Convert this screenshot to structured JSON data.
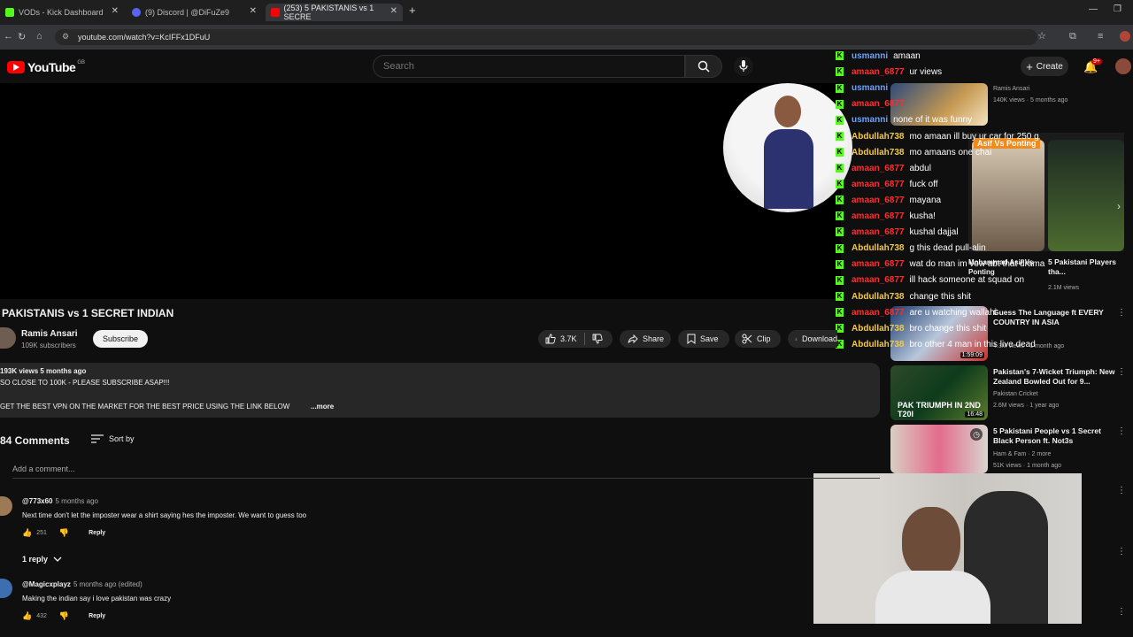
{
  "browser": {
    "tabs": [
      {
        "label": "VODs - Kick Dashboard",
        "color": "#53fc18"
      },
      {
        "label": "(9) Discord | @DiFuZe9",
        "color": "#5865f2"
      },
      {
        "label": "(253) 5 PAKISTANIS vs 1 SECRE",
        "color": "#ff0000"
      }
    ],
    "url": "youtube.com/watch?v=KcIFFx1DFuU"
  },
  "header": {
    "logo_text": "YouTube",
    "country": "GB",
    "search_placeholder": "Search",
    "create_label": "Create",
    "notif_badge": "9+"
  },
  "chat": {
    "lines": [
      {
        "user": "usmanni",
        "msg": "amaan",
        "color": "#6aa2ff"
      },
      {
        "user": "amaan_6877",
        "msg": "ur views",
        "color": "#ff2d2d"
      },
      {
        "user": "usmanni",
        "msg": "",
        "color": "#6aa2ff"
      },
      {
        "user": "amaan_6877",
        "msg": "",
        "color": "#ff2d2d"
      },
      {
        "user": "usmanni",
        "msg": "none of it was funny",
        "color": "#6aa2ff"
      },
      {
        "user": "Abdullah738",
        "msg": "mo amaan ill buy ur car for 250 g",
        "color": "#f2c94c"
      },
      {
        "user": "Abdullah738",
        "msg": "mo amaans one chai",
        "color": "#f2c94c"
      },
      {
        "user": "amaan_6877",
        "msg": "abdul",
        "color": "#ff2d2d"
      },
      {
        "user": "amaan_6877",
        "msg": "fuck off",
        "color": "#ff2d2d"
      },
      {
        "user": "amaan_6877",
        "msg": "mayana",
        "color": "#ff2d2d"
      },
      {
        "user": "amaan_6877",
        "msg": "kusha!",
        "color": "#ff2d2d"
      },
      {
        "user": "amaan_6877",
        "msg": "kushal dajjal",
        "color": "#ff2d2d"
      },
      {
        "user": "Abdullah738",
        "msg": "g this dead pull-alin",
        "color": "#f2c94c"
      },
      {
        "user": "amaan_6877",
        "msg": "wat do man im vow abt that drama",
        "color": "#ff2d2d"
      },
      {
        "user": "amaan_6877",
        "msg": "ill hack someone at squad on",
        "color": "#ff2d2d"
      },
      {
        "user": "Abdullah738",
        "msg": "change this shit",
        "color": "#f2c94c"
      },
      {
        "user": "amaan_6877",
        "msg": "are u watching wallahi",
        "color": "#ff2d2d"
      },
      {
        "user": "Abdullah738",
        "msg": "bro change this shit",
        "color": "#f2c94c"
      },
      {
        "user": "Abdullah738",
        "msg": "bro other 4 man in this live dead",
        "color": "#f2c94c"
      }
    ]
  },
  "video": {
    "title": "PAKISTANIS vs 1 SECRET INDIAN",
    "channel": "Ramis Ansari",
    "subscribers": "109K subscribers",
    "subscribe_label": "Subscribe",
    "likes": "3.7K",
    "share_label": "Share",
    "save_label": "Save",
    "clip_label": "Clip",
    "download_label": "Download"
  },
  "description": {
    "stats": "193K views  5 months ago",
    "line1": "SO CLOSE TO 100K - PLEASE SUBSCRIBE ASAP!!!",
    "line2": "GET THE BEST VPN ON THE MARKET FOR THE BEST PRICE USING THE LINK BELOW",
    "more_label": "...more"
  },
  "comments": {
    "count_label": "84 Comments",
    "sort_label": "Sort by",
    "add_placeholder": "Add a comment...",
    "reply_label": "Reply",
    "items": [
      {
        "author": "@773x60",
        "time": "5 months ago",
        "text": "Next time don't let the imposter wear a shirt saying hes the imposter. We want to guess too",
        "likes": "251",
        "avatar": "#9b7a55"
      },
      {
        "author": "@Magicxplayz",
        "time": "5 months ago (edited)",
        "text": "Making the indian say i love pakistan was crazy",
        "likes": "432",
        "avatar": "#3d6fb0"
      }
    ],
    "replies_label": "1 reply"
  },
  "sidebar": {
    "items": [
      {
        "title": "",
        "channel": "Ramis Ansari",
        "meta": "140K views · 5 months ago",
        "duration": ""
      },
      {
        "title": "5 Pakistani Players tha...",
        "channel": "",
        "meta": "2.1M views",
        "duration": ""
      },
      {
        "title": "Mohammad Asif Vs Ponting",
        "channel": "",
        "meta": "",
        "duration": ""
      },
      {
        "title": "Guess The Language ft EVERY COUNTRY IN ASIA",
        "channel": "",
        "meta": "4.3M views · 1 month ago",
        "duration": "1:59:09"
      },
      {
        "title": "Pakistan's 7-Wicket Triumph: New Zealand Bowled Out for 9...",
        "channel": "Pakistan Cricket",
        "meta": "2.6M views · 1 year ago",
        "duration": "16:48"
      },
      {
        "title": "5 Pakistani People vs 1 Secret Black Person ft. Not3s",
        "channel": "Ham & Fam · 2 more",
        "meta": "51K views · 1 month ago",
        "duration": ""
      }
    ],
    "shelf_label": "Asif Vs Ponting",
    "shelf_caption": "PAK TRIUMPH IN 2ND T20I"
  },
  "colors": {
    "kick_green": "#53fc18",
    "yt_red": "#ff0000"
  }
}
